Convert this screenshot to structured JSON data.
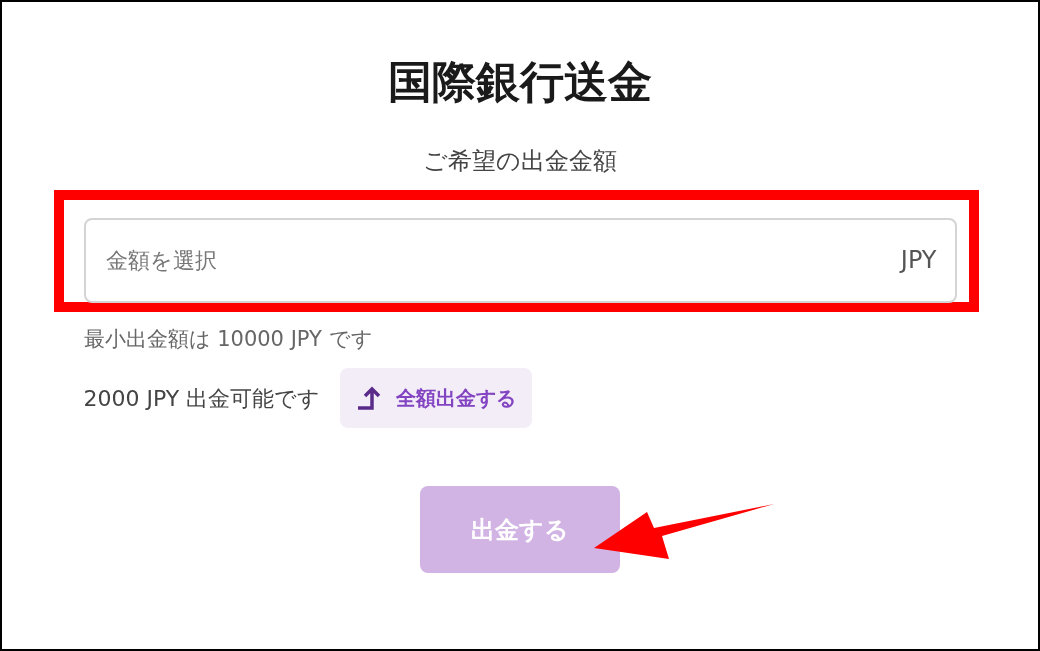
{
  "title": "国際銀行送金",
  "amount_label": "ご希望の出金金額",
  "amount_field": {
    "placeholder": "金額を選択",
    "currency": "JPY",
    "highlighted": true
  },
  "minimum_note": "最小出金額は 10000 JPY です",
  "available_note": "2000 JPY 出金可能です",
  "withdraw_all_button": "全額出金する",
  "submit_button": {
    "label": "出金する",
    "disabled": true
  },
  "arrow_annotation": true
}
